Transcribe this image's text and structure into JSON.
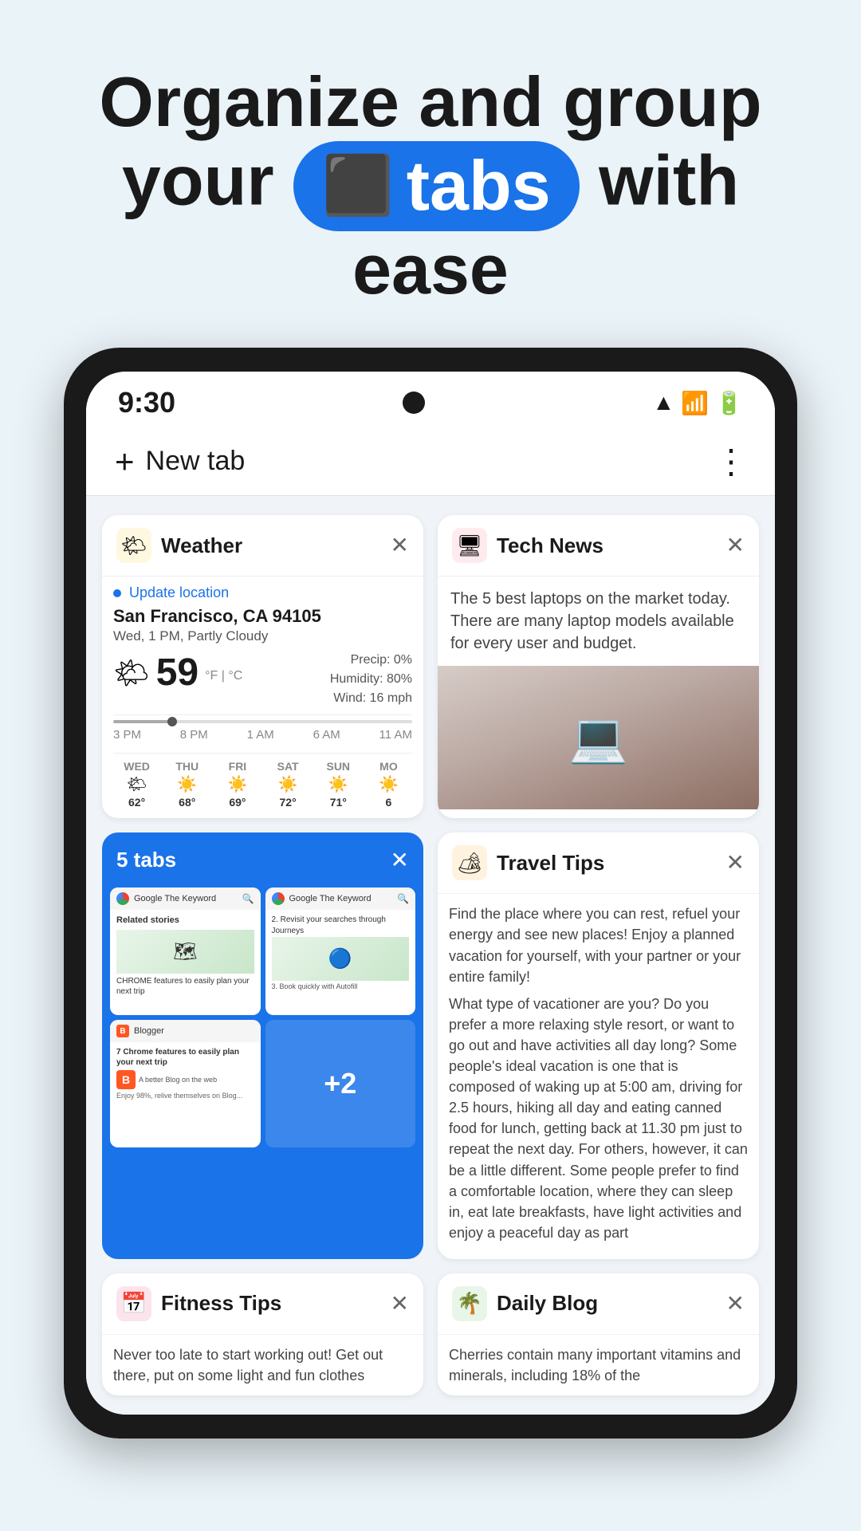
{
  "hero": {
    "line1": "Organize and group",
    "line2_pre": "your",
    "pill": {
      "icon": "⬜",
      "label": "tabs"
    },
    "line2_post": "with ease"
  },
  "status_bar": {
    "time": "9:30",
    "wifi": "▲",
    "battery": "▮"
  },
  "chrome_header": {
    "new_tab": "New tab",
    "plus": "+",
    "more": "⋮"
  },
  "weather_card": {
    "title": "Weather",
    "update_text": "Update location",
    "location": "San Francisco, CA 94105",
    "desc": "Wed, 1 PM, Partly Cloudy",
    "temp": "59",
    "unit": "°F | °C",
    "precip": "Precip: 0%",
    "humidity": "Humidity: 80%",
    "wind": "Wind: 16 mph",
    "times": [
      "3 PM",
      "8 PM",
      "1 AM",
      "6 AM",
      "11 AM"
    ],
    "forecast": [
      {
        "day": "WED",
        "icon": "🌤",
        "temp": "62°"
      },
      {
        "day": "THU",
        "icon": "☀️",
        "temp": "68°"
      },
      {
        "day": "FRI",
        "icon": "☀️",
        "temp": "69°"
      },
      {
        "day": "SAT",
        "icon": "☀️",
        "temp": "72°"
      },
      {
        "day": "SUN",
        "icon": "☀️",
        "temp": "71°"
      },
      {
        "day": "MO",
        "icon": "☀️",
        "temp": "6"
      }
    ]
  },
  "tech_news_card": {
    "title": "Tech News",
    "body": "The 5 best laptops on the market today. There are many laptop models available for every user and budget."
  },
  "tabs_group_card": {
    "label": "5 tabs",
    "mini_tabs": [
      {
        "url": "Google The Keyword",
        "headline": "Related stories"
      },
      {
        "url": "Google The Keyword",
        "headline": "2. Revisit your searches through Journeys"
      },
      {
        "label": "Blogger",
        "headline": "7 Chrome features to easily plan your next trip"
      },
      {
        "plus_label": "+2"
      }
    ]
  },
  "travel_tips_card": {
    "title": "Travel Tips",
    "body1": "Find the place where you can rest, refuel your energy and see new places! Enjoy a planned vacation for yourself, with your partner or your entire family!",
    "body2": "What type of vacationer are you? Do you prefer a more relaxing style resort, or want to go out and have activities all day long? Some people's ideal vacation is one that is composed of waking up at 5:00 am, driving for 2.5 hours, hiking all day and eating canned food for lunch, getting back at 11.30 pm just to repeat the next day. For others, however, it can be a little different. Some people prefer to find a comfortable location, where they can sleep in, eat late breakfasts, have light activities and enjoy a peaceful day as part"
  },
  "fitness_tips_card": {
    "title": "Fitness Tips",
    "body": "Never too late to start working out! Get out there, put on some light and fun clothes"
  },
  "daily_blog_card": {
    "title": "Daily Blog",
    "body": "Cherries contain many important vitamins and minerals, including 18% of the"
  }
}
